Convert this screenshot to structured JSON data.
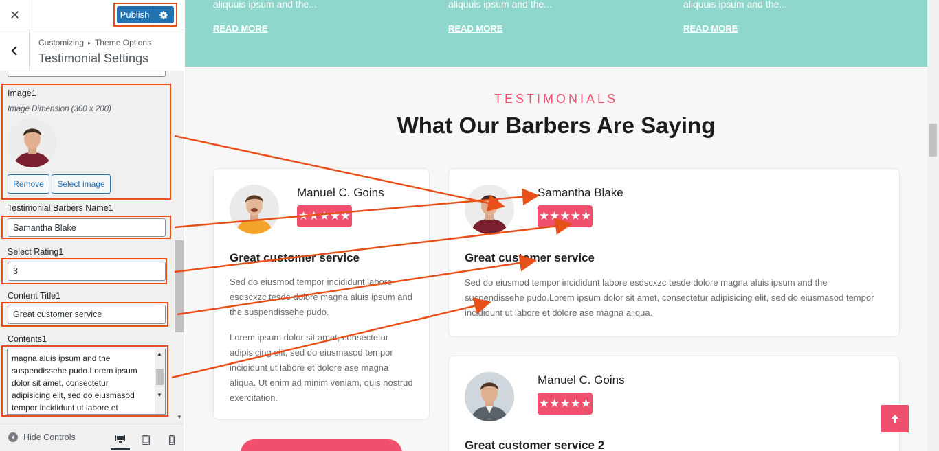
{
  "customizer": {
    "close_icon": "close-icon",
    "publish_label": "Publish",
    "breadcrumb_root": "Customizing",
    "breadcrumb_parent": "Theme Options",
    "section_title": "Testimonial Settings",
    "image_label": "Image1",
    "image_dimension": "Image Dimension (300 x 200)",
    "remove_label": "Remove",
    "select_image_label": "Select image",
    "name_label": "Testimonial Barbers Name1",
    "name_value": "Samantha Blake",
    "rating_label": "Select Rating1",
    "rating_value": "3",
    "content_title_label": "Content Title1",
    "content_title_value": "Great customer service",
    "contents_label": "Contents1",
    "contents_value": "magna aluis ipsum and the suspendissehe pudo.Lorem ipsum dolor sit amet, consectetur adipisicing elit, sed do eiusmasod tempor incididunt ut labore et",
    "hide_controls_label": "Hide Controls"
  },
  "preview": {
    "teal_snippets": [
      "aliquuis ipsum and the...",
      "aliquuis ipsum and the...",
      "aliquuis ipsum and the..."
    ],
    "read_more": "READ MORE",
    "kicker": "TESTIMONIALS",
    "heading": "What Our Barbers Are Saying",
    "stars": "★★★★★",
    "cards": [
      {
        "name": "Manuel C. Goins",
        "title": "Great customer service",
        "body1": "Sed do eiusmod tempor incididunt labore esdscxzc tesde dolore magna aluis ipsum and the suspendissehe pudo.",
        "body2": "Lorem ipsum dolor sit amet, consectetur adipisicing elit, sed do eiusmasod tempor incididunt ut labore et dolore ase magna aliqua. Ut enim ad minim veniam, quis nostrud exercitation."
      },
      {
        "name": "Samantha Blake",
        "title": "Great customer service",
        "body1": "Sed do eiusmod tempor incididunt labore esdscxzc tesde dolore magna aluis ipsum and the suspendissehe pudo.Lorem ipsum dolor sit amet, consectetur adipisicing elit, sed do eiusmasod tempor incididunt ut labore et dolore ase magna aliqua."
      },
      {
        "name": "Manuel C. Goins",
        "title": "Great customer service 2"
      }
    ]
  },
  "colors": {
    "accent": "#f0506e",
    "teal": "#8fd6cc",
    "wp_blue": "#2271b1",
    "highlight": "#e8501a"
  }
}
